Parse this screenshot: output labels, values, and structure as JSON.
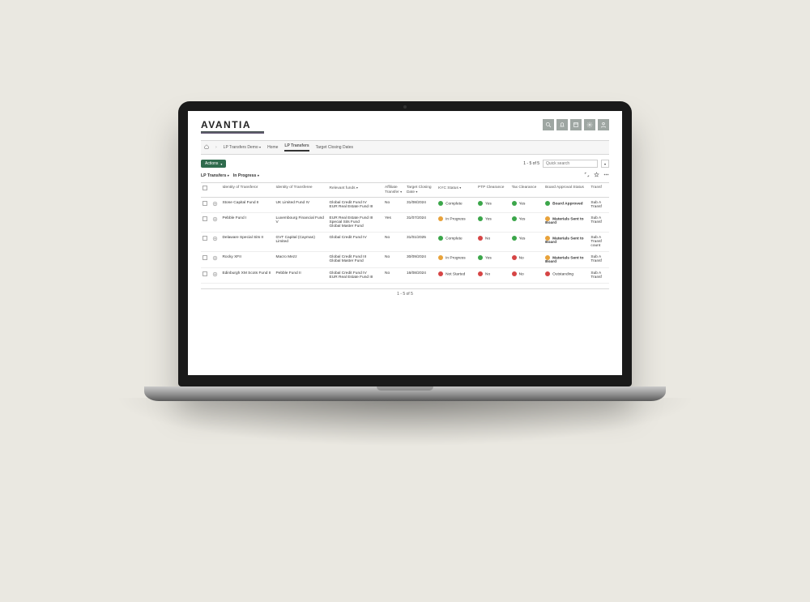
{
  "brand": "AVANTIA",
  "breadcrumb": {
    "root": "LP Transfers Demo",
    "items": [
      "Home",
      "LP Transfers",
      "Target Closing Dates"
    ],
    "active_index": 1
  },
  "subbar": {
    "actions_label": "Actions",
    "range": "1 - 5 of 5",
    "quick_search_placeholder": "Quick search"
  },
  "filters": {
    "left": [
      "LP Transfers",
      "In Progress"
    ]
  },
  "table": {
    "headers": {
      "transferor": "Identity of Transferor",
      "transferee": "Identity of Transferee",
      "funds": "Relevant funds",
      "affiliate": "Affiliate Transfer",
      "target_date": "Target Closing Date",
      "kyc": "KYC Status",
      "ptp": "PTP Clearance",
      "tax": "Tax Clearance",
      "board": "Board Approval Status",
      "transfer": "Transf"
    },
    "rows": [
      {
        "transferor": "Stone Capital Fund II",
        "transferee": "UK Limited Fund IV",
        "funds": "Global Credit Fund IV\nEUR Real Estate Fund III",
        "affiliate": "No",
        "target_date": "31/08/2024",
        "kyc": {
          "color": "g",
          "label": "Complete"
        },
        "ptp": {
          "color": "g",
          "label": "Yes"
        },
        "tax": {
          "color": "g",
          "label": "Yes"
        },
        "board": {
          "color": "g",
          "label": "Board Approved",
          "bold": true
        },
        "transfer": "Sub A Transf"
      },
      {
        "transferor": "Pebble Fund I",
        "transferee": "Luxembourg Financial Fund V",
        "funds": "EUR Real Estate Fund III\nSpecial Sits Fund\nGlobal Master Fund",
        "affiliate": "Yes",
        "target_date": "31/07/2024",
        "kyc": {
          "color": "o",
          "label": "In Progress"
        },
        "ptp": {
          "color": "g",
          "label": "Yes"
        },
        "tax": {
          "color": "g",
          "label": "Yes"
        },
        "board": {
          "color": "o",
          "label": "Materials Sent to Board",
          "bold": true
        },
        "transfer": "Sub A Transf"
      },
      {
        "transferor": "Delaware Special Sits II",
        "transferee": "GVT Capital (Cayman) Limited",
        "funds": "Global Credit Fund IV",
        "affiliate": "No",
        "target_date": "31/01/2025",
        "kyc": {
          "color": "g",
          "label": "Complete"
        },
        "ptp": {
          "color": "r",
          "label": "No"
        },
        "tax": {
          "color": "g",
          "label": "Yes"
        },
        "board": {
          "color": "o",
          "label": "Materials Sent to Board",
          "bold": true
        },
        "transfer": "Sub A Transf count"
      },
      {
        "transferor": "Rocky XFII",
        "transferee": "Macro Mezz",
        "funds": "Global Credit Fund III\nGlobal Master Fund",
        "affiliate": "No",
        "target_date": "30/09/2024",
        "kyc": {
          "color": "o",
          "label": "In Progress"
        },
        "ptp": {
          "color": "g",
          "label": "Yes"
        },
        "tax": {
          "color": "r",
          "label": "No"
        },
        "board": {
          "color": "o",
          "label": "Materials Sent to Board",
          "bold": true
        },
        "transfer": "Sub A Transf"
      },
      {
        "transferor": "Edinburgh XM Scots Fund II",
        "transferee": "Pebble Fund II",
        "funds": "Global Credit Fund IV\nEUR Real Estate Fund III",
        "affiliate": "No",
        "target_date": "16/08/2024",
        "kyc": {
          "color": "r",
          "label": "Not Started"
        },
        "ptp": {
          "color": "r",
          "label": "No"
        },
        "tax": {
          "color": "r",
          "label": "No"
        },
        "board": {
          "color": "r",
          "label": "Outstanding"
        },
        "transfer": "Sub A Transf"
      }
    ],
    "footer_range": "1 - 5 of 5"
  }
}
